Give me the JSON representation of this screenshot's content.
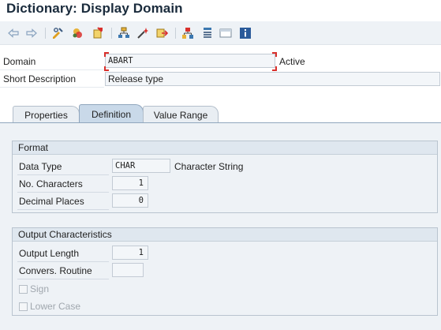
{
  "window": {
    "title": "Dictionary: Display Domain"
  },
  "toolbar": {
    "icons": [
      "back-arrow-icon",
      "forward-arrow-icon",
      "display-change-icon",
      "other-object-icon",
      "activate-icon",
      "hierarchy-icon",
      "magic-wand-icon",
      "transport-icon",
      "where-used-icon",
      "list-icon",
      "screen-icon",
      "info-icon"
    ]
  },
  "header": {
    "domain_label": "Domain",
    "domain_value": "ABART",
    "status": "Active",
    "short_desc_label": "Short Description",
    "short_desc_value": "Release type"
  },
  "tabs": [
    {
      "label": "Properties",
      "active": false
    },
    {
      "label": "Definition",
      "active": true
    },
    {
      "label": "Value Range",
      "active": false
    }
  ],
  "format": {
    "title": "Format",
    "data_type_label": "Data Type",
    "data_type_value": "CHAR",
    "data_type_desc": "Character String",
    "no_chars_label": "No. Characters",
    "no_chars_value": "1",
    "decimal_label": "Decimal Places",
    "decimal_value": "0"
  },
  "output": {
    "title": "Output Characteristics",
    "length_label": "Output Length",
    "length_value": "1",
    "routine_label": "Convers. Routine",
    "routine_value": "",
    "sign_label": "Sign",
    "sign_checked": false,
    "lower_label": "Lower Case",
    "lower_checked": false
  },
  "colors": {
    "accent": "#d9302c",
    "tab_active": "#c9d9e9",
    "panel": "#eef2f6"
  }
}
